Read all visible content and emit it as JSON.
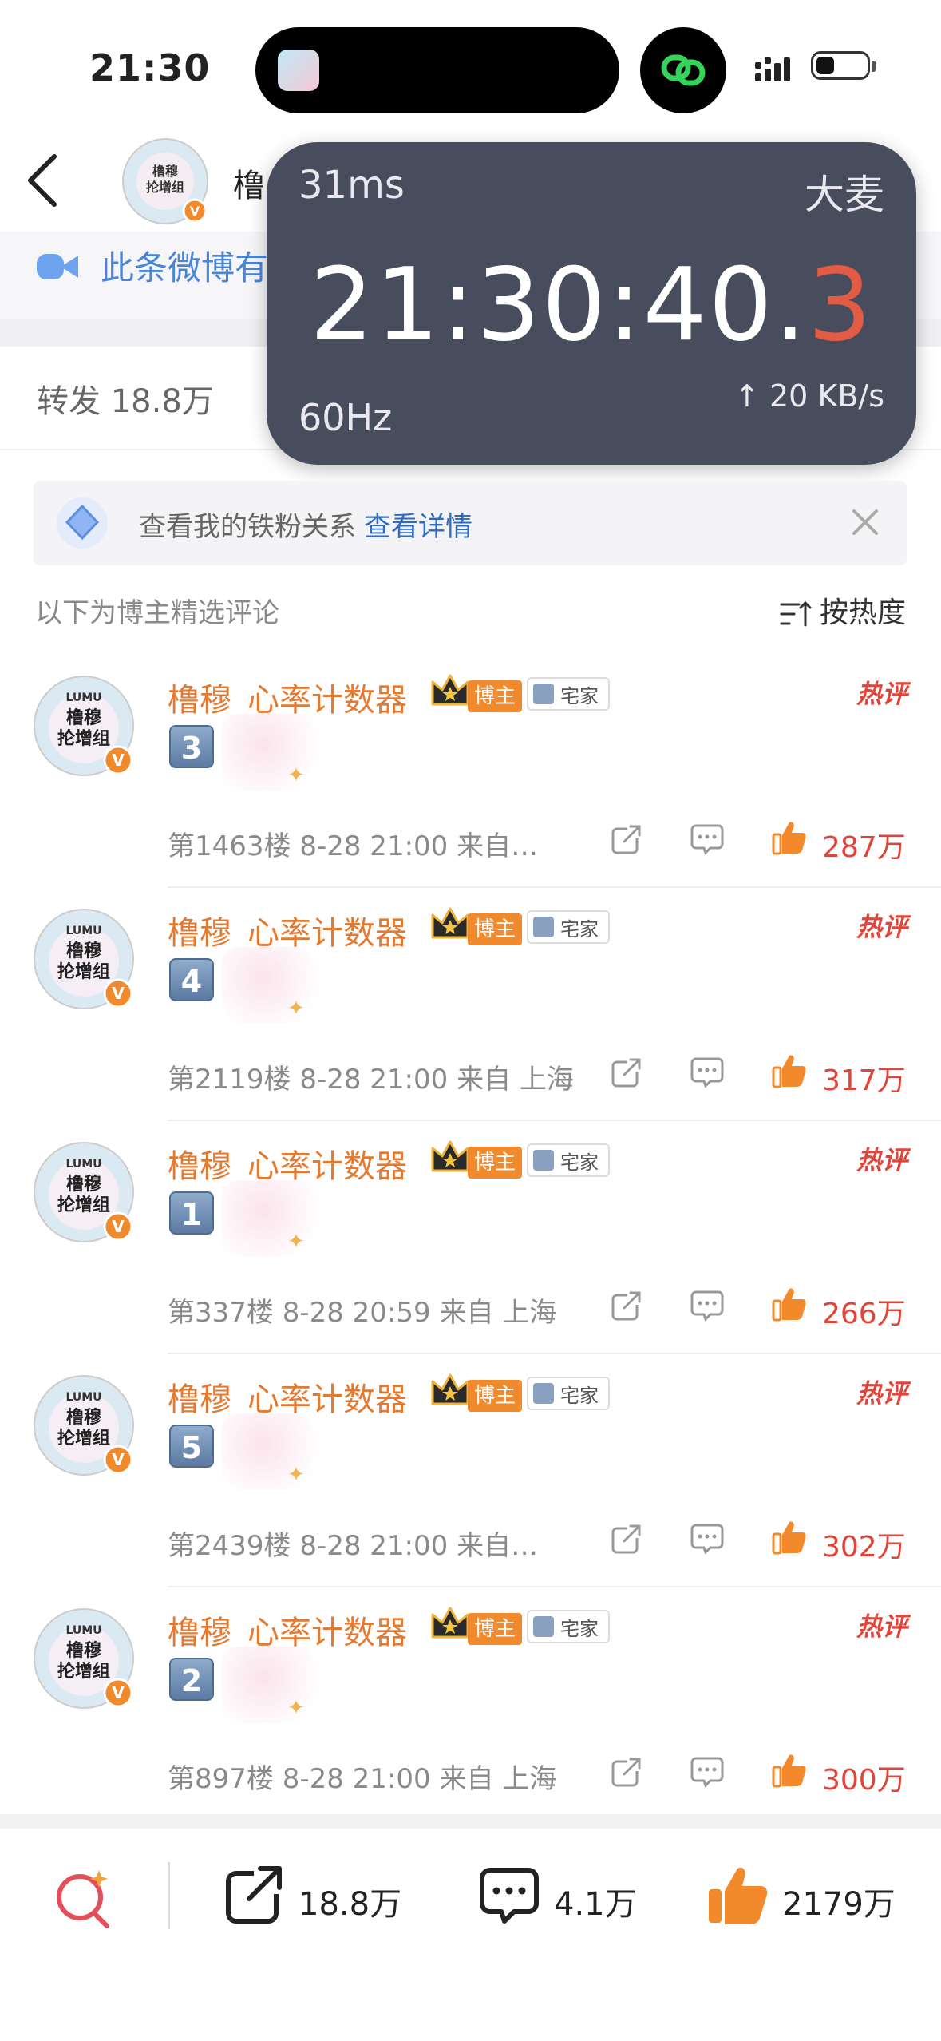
{
  "status_bar": {
    "time": "21:30"
  },
  "header": {
    "name_partial": "橹",
    "banner_text": "此条微博有"
  },
  "stats_row": {
    "repost_label": "转发 18.8万"
  },
  "overlay": {
    "ping": "31ms",
    "app": "大麦",
    "clock_main": "21:30:40.",
    "clock_tenth": "3",
    "refresh_rate": "60Hz",
    "network": "↑ 20 KB/s"
  },
  "fans_card": {
    "text": "查看我的铁粉关系",
    "link": "查看详情"
  },
  "section": {
    "title": "以下为博主精选评论",
    "sort_label": "按热度"
  },
  "comments": [
    {
      "name": "橹穆_心率计数器",
      "badge_blogger": "博主",
      "badge_home": "宅家",
      "hot": "热评",
      "number": "3",
      "meta": "第1463楼 8-28 21:00 来自…",
      "likes": "287万"
    },
    {
      "name": "橹穆_心率计数器",
      "badge_blogger": "博主",
      "badge_home": "宅家",
      "hot": "热评",
      "number": "4",
      "meta": "第2119楼 8-28 21:00 来自 上海",
      "likes": "317万"
    },
    {
      "name": "橹穆_心率计数器",
      "badge_blogger": "博主",
      "badge_home": "宅家",
      "hot": "热评",
      "number": "1",
      "meta": "第337楼 8-28 20:59 来自 上海",
      "likes": "266万"
    },
    {
      "name": "橹穆_心率计数器",
      "badge_blogger": "博主",
      "badge_home": "宅家",
      "hot": "热评",
      "number": "5",
      "meta": "第2439楼 8-28 21:00 来自…",
      "likes": "302万"
    },
    {
      "name": "橹穆_心率计数器",
      "badge_blogger": "博主",
      "badge_home": "宅家",
      "hot": "热评",
      "number": "2",
      "meta": "第897楼 8-28 21:00 来自 上海",
      "likes": "300万"
    }
  ],
  "bottom_bar": {
    "reposts": "18.8万",
    "comments": "4.1万",
    "likes": "2179万"
  },
  "colors": {
    "accent_orange": "#e5792f",
    "like_red": "#e0453a",
    "link_blue": "#2d6bc4",
    "overlay_bg": "#424758"
  }
}
